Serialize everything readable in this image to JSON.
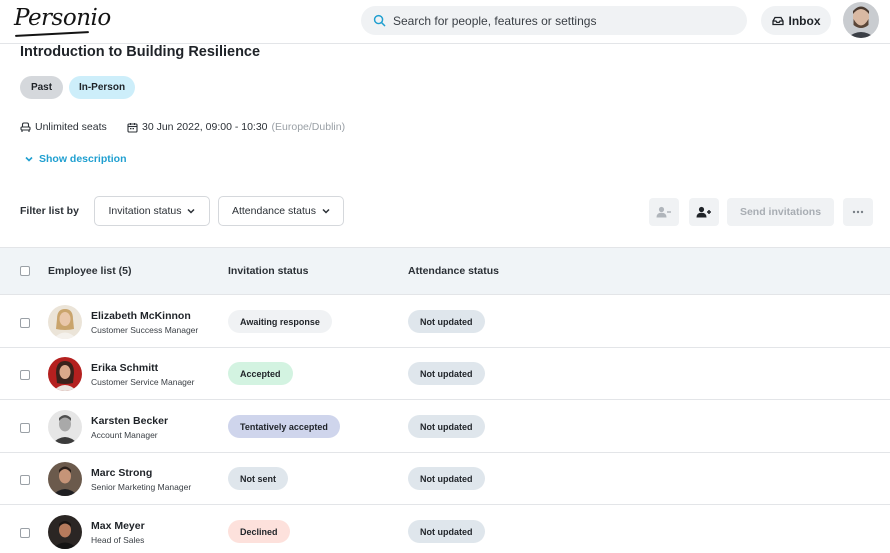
{
  "colors": {
    "accent": "#1f9fd0",
    "awaiting": "#f0f2f4",
    "accepted": "#d3f3e1",
    "tentative": "#cfd5ec",
    "not_sent": "#dfe6ec",
    "declined": "#fde1dc",
    "not_updated": "#dfe6ec"
  },
  "header": {
    "logo": "Personio",
    "search_placeholder": "Search for people, features or settings",
    "inbox_label": "Inbox"
  },
  "event": {
    "title": "Introduction to Building Resilience",
    "tags": [
      "Past",
      "In-Person"
    ],
    "seats": "Unlimited seats",
    "datetime": "30 Jun 2022, 09:00 - 10:30",
    "timezone": "(Europe/Dublin)",
    "show_description": "Show description"
  },
  "filters": {
    "label": "Filter list by",
    "invitation_status": "Invitation status",
    "attendance_status": "Attendance status",
    "send_invitations": "Send invitations"
  },
  "table": {
    "columns": [
      "Employee list (5)",
      "Invitation status",
      "Attendance status"
    ],
    "rows": [
      {
        "name": "Elizabeth McKinnon",
        "role": "Customer Success Manager",
        "invitation": "Awaiting response",
        "invitation_color": "awaiting",
        "attendance": "Not updated"
      },
      {
        "name": "Erika Schmitt",
        "role": "Customer Service Manager",
        "invitation": "Accepted",
        "invitation_color": "accepted",
        "attendance": "Not updated"
      },
      {
        "name": "Karsten Becker",
        "role": "Account Manager",
        "invitation": "Tentatively accepted",
        "invitation_color": "tentative",
        "attendance": "Not updated"
      },
      {
        "name": "Marc Strong",
        "role": "Senior Marketing Manager",
        "invitation": "Not sent",
        "invitation_color": "not_sent",
        "attendance": "Not updated"
      },
      {
        "name": "Max Meyer",
        "role": "Head of Sales",
        "invitation": "Declined",
        "invitation_color": "declined",
        "attendance": "Not updated"
      }
    ]
  }
}
